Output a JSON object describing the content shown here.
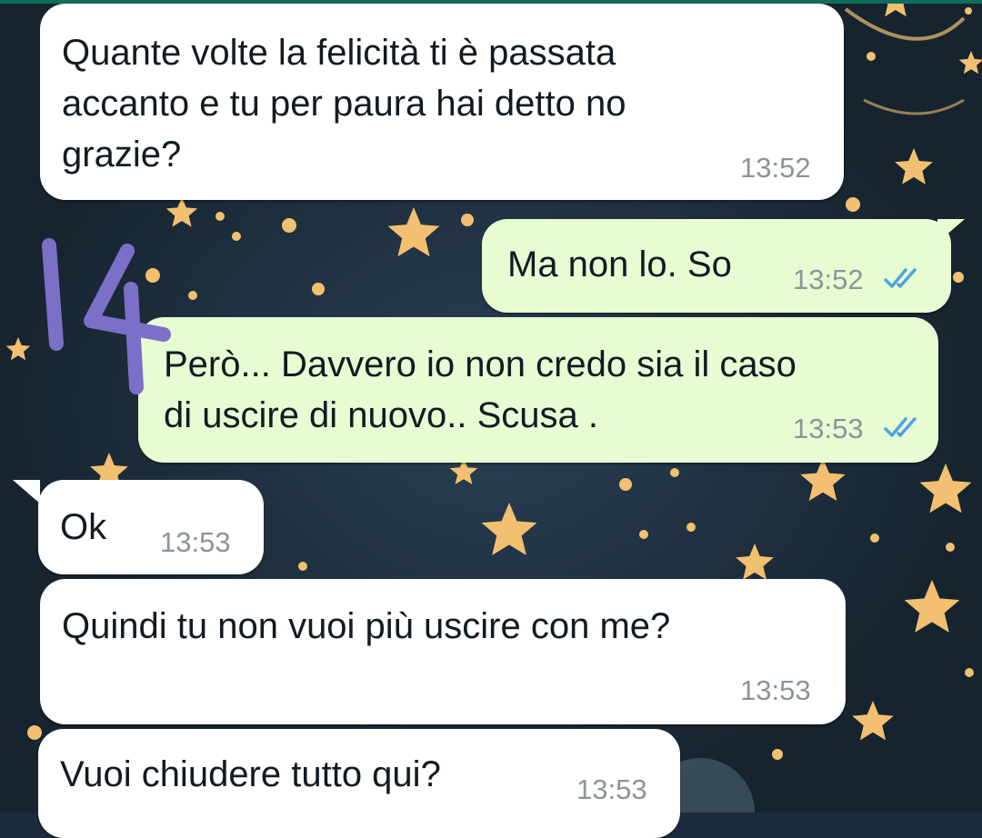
{
  "theme": {
    "wallpaper": "#1a2b3b",
    "incoming_bubble": "#ffffff",
    "outgoing_bubble": "#e8fcd4",
    "read_ticks": "#4fa3e0",
    "star_color": "#f2c070",
    "annotation_color": "#7b6fc8"
  },
  "annotation": {
    "icon": "handwritten-14",
    "text": "14"
  },
  "messages": [
    {
      "direction": "incoming",
      "text": "Quante volte la felicità ti è passata\naccanto e tu per paura hai detto no\ngrazie?",
      "time": "13:52"
    },
    {
      "direction": "outgoing",
      "text": "Ma non lo. So",
      "time": "13:52",
      "status": "read"
    },
    {
      "direction": "outgoing",
      "text": "Però... Davvero io non credo sia il caso\ndi uscire di nuovo.. Scusa .",
      "time": "13:53",
      "status": "read"
    },
    {
      "direction": "incoming",
      "text": "Ok",
      "time": "13:53"
    },
    {
      "direction": "incoming",
      "text": "Quindi tu non vuoi più uscire con me?",
      "time": "13:53"
    },
    {
      "direction": "incoming",
      "text": "Vuoi chiudere tutto qui?",
      "time": "13:53"
    }
  ]
}
